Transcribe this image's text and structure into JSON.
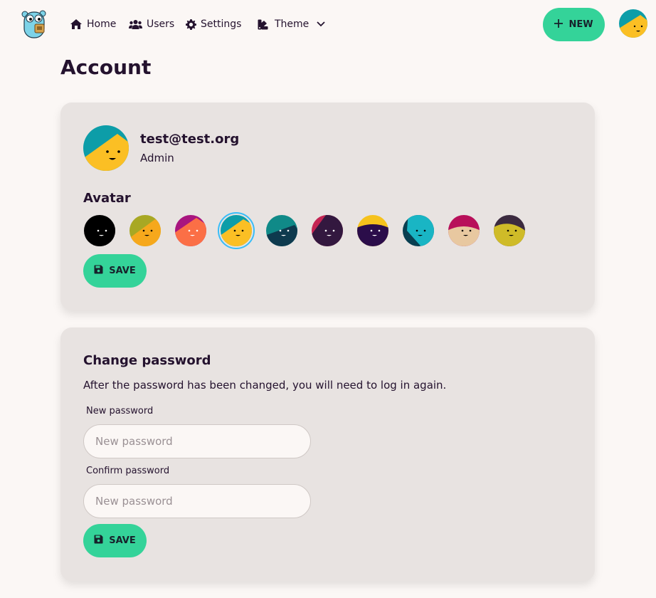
{
  "nav": {
    "logo_icon": "gopher-logo-icon",
    "items": [
      {
        "label": "Home",
        "icon": "home-icon"
      },
      {
        "label": "Users",
        "icon": "users-icon"
      },
      {
        "label": "Settings",
        "icon": "gear-icon"
      }
    ],
    "theme": {
      "label": "Theme",
      "icon": "palette-icon",
      "chevron": "chevron-down-icon"
    },
    "new_button": {
      "label": "NEW",
      "icon": "plus-icon"
    },
    "user_avatar": "avatar-face-icon"
  },
  "page": {
    "title": "Account"
  },
  "profile": {
    "email": "test@test.org",
    "role": "Admin"
  },
  "avatar_section": {
    "title": "Avatar",
    "selected_index": 3,
    "options": [
      {
        "bg": "#000000",
        "accent": "#000000",
        "face": "#000000",
        "eyes": "#ffffff"
      },
      {
        "bg": "#a8a824",
        "accent": "#a8a824",
        "face": "#f6a81c",
        "eyes": "#000000"
      },
      {
        "bg": "#a8157f",
        "accent": "#a8157f",
        "face": "#fb6f46",
        "eyes": "#ffffff"
      },
      {
        "bg": "#0d9da8",
        "accent": "#0d9da8",
        "face": "#fbbf24",
        "eyes": "#000000"
      },
      {
        "bg": "#108a88",
        "accent": "#108a88",
        "face": "#0e3a4e",
        "eyes": "#ffffff"
      },
      {
        "bg": "#c42453",
        "accent": "#c42453",
        "face": "#33183f",
        "eyes": "#ffffff"
      },
      {
        "bg": "#f6c21c",
        "accent": "#f6c21c",
        "face": "#2b0d4a",
        "eyes": "#ffffff"
      },
      {
        "bg": "#083f50",
        "accent": "#083f50",
        "face": "#19b5c4",
        "eyes": "#000000"
      },
      {
        "bg": "#b8105a",
        "accent": "#b8105a",
        "face": "#e8c8a0",
        "eyes": "#000000"
      },
      {
        "bg": "#3b2a3f",
        "accent": "#3b2a3f",
        "face": "#cfbb28",
        "eyes": "#000000"
      }
    ],
    "save_label": "SAVE",
    "save_icon": "floppy-disk-icon"
  },
  "password_section": {
    "title": "Change password",
    "description": "After the password has been changed, you will need to log in again.",
    "new_password_label": "New password",
    "new_password_placeholder": "New password",
    "confirm_password_label": "Confirm password",
    "confirm_password_placeholder": "New password",
    "save_label": "SAVE",
    "save_icon": "floppy-disk-icon"
  },
  "colors": {
    "background": "#fbf7f5",
    "card": "#e8e3e1",
    "accent": "#34d399",
    "text": "#24122e",
    "selected_ring": "#38bdf8"
  }
}
